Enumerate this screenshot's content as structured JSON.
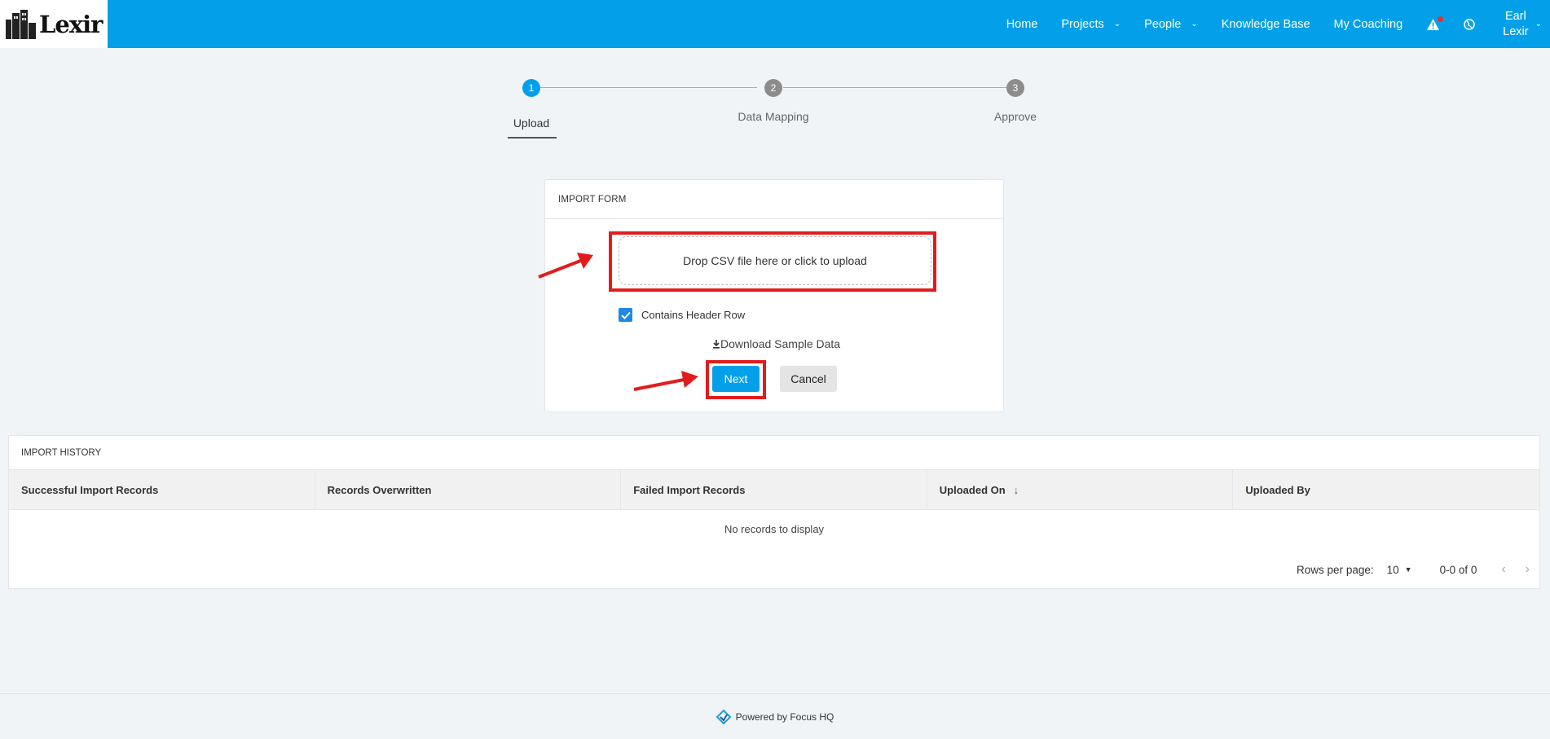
{
  "header": {
    "logo_text": "Lexir",
    "nav": [
      {
        "label": "Home"
      },
      {
        "label": "Projects"
      },
      {
        "label": "People"
      },
      {
        "label": "Knowledge Base"
      },
      {
        "label": "My Coaching"
      }
    ],
    "user": {
      "first": "Earl",
      "last": "Lexir"
    },
    "icons": [
      "alert-icon",
      "globe-icon",
      "chevron-down-icon"
    ]
  },
  "stepper": {
    "steps": [
      {
        "number": "1",
        "label": "Upload",
        "active": true
      },
      {
        "number": "2",
        "label": "Data Mapping",
        "active": false
      },
      {
        "number": "3",
        "label": "Approve",
        "active": false
      }
    ],
    "active_color": "#03a0e9",
    "inactive_color": "#8c8c8c"
  },
  "import_form": {
    "title": "IMPORT FORM",
    "dropzone_text": "Drop CSV file here or click to upload",
    "header_row_label": "Contains Header Row",
    "header_row_checked": true,
    "download_label": "Download Sample Data",
    "next_label": "Next",
    "cancel_label": "Cancel"
  },
  "import_history": {
    "title": "IMPORT HISTORY",
    "columns": [
      "Successful Import Records",
      "Records Overwritten",
      "Failed Import Records",
      "Uploaded On",
      "Uploaded By"
    ],
    "empty_text": "No records to display",
    "rows_per_page_label": "Rows per page:",
    "rows_per_page": "10",
    "range": "0-0 of 0"
  },
  "footer": {
    "text": "Powered by Focus HQ"
  },
  "colors": {
    "brand": "#03a0e9",
    "annotation": "#e21c1c"
  }
}
